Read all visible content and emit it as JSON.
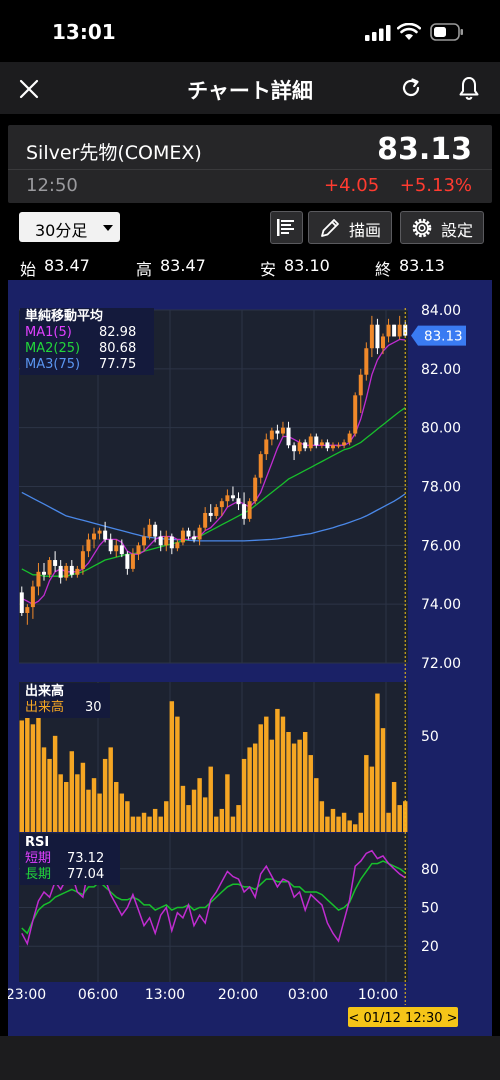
{
  "status_bar": {
    "time": "13:01"
  },
  "header": {
    "title": "チャート詳細"
  },
  "instrument": {
    "name": "Silver先物(COMEX)",
    "price": "83.13",
    "time": "12:50",
    "change": "+4.05",
    "change_pct": "+5.13%"
  },
  "toolbar": {
    "interval": "30分足",
    "draw_label": "描画",
    "settings_label": "設定"
  },
  "ohlc": {
    "open_label": "始",
    "open": "83.47",
    "high_label": "高",
    "high": "83.47",
    "low_label": "安",
    "low": "83.10",
    "close_label": "終",
    "close": "83.13"
  },
  "legends": {
    "ma_title": "単純移動平均",
    "ma1_label": "MA1(5)",
    "ma1_value": "82.98",
    "ma2_label": "MA2(25)",
    "ma2_value": "80.68",
    "ma3_label": "MA3(75)",
    "ma3_value": "77.75",
    "volume_title": "出来高",
    "volume_label": "出来高",
    "volume_value": "30",
    "rsi_title": "RSI",
    "rsi_short_label": "短期",
    "rsi_short_value": "73.12",
    "rsi_long_label": "長期",
    "rsi_long_value": "77.04"
  },
  "colors": {
    "up_candle": "#f0892a",
    "down_candle": "#ffffff",
    "ma1": "#c02cd0",
    "ma2": "#18c02c",
    "ma3": "#4a88e8",
    "volume": "#f5a623",
    "rsi_short": "#c02cd0",
    "rsi_long": "#18c02c",
    "chart_bg": "#1a2166",
    "crosshair": "#f5c518",
    "price_tag": "#3a7bf2"
  },
  "chart_data": [
    {
      "type": "candlestick",
      "title": "単純移動平均",
      "y_ticks": [
        "84.00",
        "82.00",
        "80.00",
        "78.00",
        "76.00",
        "74.00",
        "72.00"
      ],
      "ylim": [
        72,
        84
      ],
      "x_ticks": [
        "23:00",
        "06:00",
        "13:00",
        "20:00",
        "03:00",
        "10:00"
      ],
      "current_price_label": "83.13",
      "cursor_label": "< 01/12 12:30 >",
      "candles": [
        [
          74.4,
          74.6,
          73.6,
          73.7
        ],
        [
          73.7,
          74.0,
          73.3,
          73.9
        ],
        [
          73.9,
          74.8,
          73.5,
          74.6
        ],
        [
          74.6,
          75.4,
          74.3,
          75.1
        ],
        [
          75.1,
          75.4,
          74.8,
          75.0
        ],
        [
          75.0,
          75.6,
          74.9,
          75.5
        ],
        [
          75.5,
          75.8,
          75.1,
          75.3
        ],
        [
          75.3,
          75.5,
          74.7,
          74.9
        ],
        [
          74.9,
          75.4,
          74.8,
          75.3
        ],
        [
          75.3,
          75.5,
          74.9,
          75.0
        ],
        [
          75.0,
          75.3,
          74.9,
          75.2
        ],
        [
          75.2,
          76.0,
          75.0,
          75.8
        ],
        [
          75.8,
          76.4,
          75.6,
          76.2
        ],
        [
          76.2,
          76.6,
          75.9,
          76.4
        ],
        [
          76.4,
          76.6,
          76.2,
          76.5
        ],
        [
          76.5,
          76.8,
          76.1,
          76.2
        ],
        [
          76.2,
          76.4,
          75.7,
          75.8
        ],
        [
          75.8,
          76.2,
          75.6,
          76.0
        ],
        [
          76.0,
          76.2,
          75.6,
          75.7
        ],
        [
          75.7,
          75.8,
          75.0,
          75.2
        ],
        [
          75.2,
          75.9,
          75.1,
          75.7
        ],
        [
          75.7,
          76.1,
          75.5,
          76.0
        ],
        [
          76.0,
          76.6,
          75.8,
          76.3
        ],
        [
          76.3,
          76.9,
          76.2,
          76.7
        ],
        [
          76.7,
          76.8,
          76.1,
          76.3
        ],
        [
          76.3,
          76.5,
          75.8,
          76.0
        ],
        [
          76.0,
          76.5,
          75.8,
          76.3
        ],
        [
          76.3,
          76.4,
          75.7,
          75.9
        ],
        [
          75.9,
          76.2,
          75.8,
          76.1
        ],
        [
          76.1,
          76.6,
          76.0,
          76.5
        ],
        [
          76.5,
          76.6,
          76.2,
          76.3
        ],
        [
          76.3,
          76.5,
          76.1,
          76.2
        ],
        [
          76.2,
          76.7,
          76.0,
          76.6
        ],
        [
          76.6,
          77.3,
          76.5,
          77.1
        ],
        [
          77.1,
          77.4,
          76.8,
          77.0
        ],
        [
          77.0,
          77.4,
          76.9,
          77.3
        ],
        [
          77.3,
          77.6,
          77.0,
          77.5
        ],
        [
          77.5,
          77.9,
          77.3,
          77.7
        ],
        [
          77.7,
          78.0,
          77.5,
          77.6
        ],
        [
          77.6,
          77.8,
          77.2,
          77.4
        ],
        [
          77.4,
          77.8,
          76.7,
          76.9
        ],
        [
          76.9,
          77.6,
          76.8,
          77.5
        ],
        [
          77.5,
          78.4,
          77.4,
          78.3
        ],
        [
          78.3,
          79.2,
          78.1,
          79.1
        ],
        [
          79.1,
          79.8,
          78.9,
          79.6
        ],
        [
          79.6,
          80.0,
          79.4,
          79.9
        ],
        [
          79.9,
          80.1,
          79.6,
          79.8
        ],
        [
          79.8,
          80.2,
          79.7,
          80.0
        ],
        [
          80.0,
          80.2,
          79.3,
          79.4
        ],
        [
          79.4,
          79.5,
          78.9,
          79.2
        ],
        [
          79.2,
          79.6,
          79.1,
          79.5
        ],
        [
          79.5,
          79.6,
          79.2,
          79.3
        ],
        [
          79.3,
          79.8,
          79.2,
          79.7
        ],
        [
          79.7,
          79.8,
          79.3,
          79.4
        ],
        [
          79.4,
          79.6,
          79.3,
          79.5
        ],
        [
          79.5,
          79.6,
          79.2,
          79.3
        ],
        [
          79.3,
          79.5,
          79.2,
          79.4
        ],
        [
          79.4,
          79.5,
          79.3,
          79.4
        ],
        [
          79.4,
          79.6,
          79.3,
          79.5
        ],
        [
          79.5,
          79.9,
          79.4,
          79.8
        ],
        [
          79.8,
          81.2,
          79.7,
          81.1
        ],
        [
          81.1,
          82.0,
          80.5,
          81.8
        ],
        [
          81.8,
          82.9,
          81.6,
          82.7
        ],
        [
          82.7,
          83.8,
          82.4,
          83.5
        ],
        [
          83.5,
          83.7,
          82.5,
          82.7
        ],
        [
          82.7,
          83.2,
          82.5,
          83.1
        ],
        [
          83.1,
          83.7,
          82.9,
          83.5
        ],
        [
          83.5,
          83.5,
          83.1,
          83.1
        ],
        [
          83.1,
          83.8,
          83.0,
          83.5
        ],
        [
          83.5,
          83.6,
          83.1,
          83.13
        ]
      ],
      "ma1": [
        74.2,
        74.1,
        74.0,
        74.1,
        74.3,
        74.8,
        75.1,
        75.2,
        75.1,
        75.1,
        75.1,
        75.2,
        75.4,
        75.7,
        76.0,
        76.2,
        76.2,
        76.2,
        76.1,
        75.8,
        75.7,
        75.7,
        75.8,
        76.0,
        76.2,
        76.3,
        76.3,
        76.3,
        76.2,
        76.2,
        76.2,
        76.3,
        76.3,
        76.5,
        76.6,
        76.8,
        77.0,
        77.3,
        77.4,
        77.5,
        77.4,
        77.3,
        77.5,
        77.8,
        78.3,
        78.8,
        79.3,
        79.7,
        79.7,
        79.6,
        79.5,
        79.4,
        79.4,
        79.4,
        79.4,
        79.4,
        79.4,
        79.4,
        79.4,
        79.5,
        79.8,
        80.3,
        81.0,
        81.8,
        82.3,
        82.6,
        82.8,
        82.9,
        83.0,
        82.98
      ],
      "ma2": [
        75.2,
        75.1,
        75.0,
        75.0,
        74.95,
        74.95,
        74.95,
        74.95,
        74.95,
        75.0,
        75.05,
        75.1,
        75.2,
        75.3,
        75.4,
        75.5,
        75.55,
        75.6,
        75.65,
        75.7,
        75.72,
        75.75,
        75.8,
        75.85,
        75.9,
        75.95,
        76.0,
        76.05,
        76.1,
        76.15,
        76.2,
        76.25,
        76.3,
        76.4,
        76.5,
        76.6,
        76.7,
        76.8,
        76.9,
        77.0,
        77.1,
        77.2,
        77.35,
        77.5,
        77.65,
        77.8,
        77.95,
        78.1,
        78.25,
        78.35,
        78.45,
        78.55,
        78.65,
        78.75,
        78.85,
        78.95,
        79.05,
        79.15,
        79.25,
        79.3,
        79.4,
        79.5,
        79.65,
        79.8,
        79.95,
        80.1,
        80.25,
        80.4,
        80.55,
        80.68
      ],
      "ma3": [
        77.8,
        77.7,
        77.6,
        77.5,
        77.4,
        77.3,
        77.2,
        77.1,
        77.0,
        76.95,
        76.9,
        76.85,
        76.8,
        76.75,
        76.7,
        76.65,
        76.6,
        76.55,
        76.5,
        76.45,
        76.4,
        76.35,
        76.3,
        76.27,
        76.25,
        76.23,
        76.21,
        76.2,
        76.19,
        76.18,
        76.17,
        76.16,
        76.15,
        76.15,
        76.15,
        76.15,
        76.15,
        76.15,
        76.15,
        76.15,
        76.15,
        76.16,
        76.17,
        76.18,
        76.19,
        76.2,
        76.22,
        76.25,
        76.28,
        76.31,
        76.34,
        76.37,
        76.4,
        76.45,
        76.5,
        76.55,
        76.6,
        76.66,
        76.72,
        76.78,
        76.85,
        76.92,
        77.0,
        77.1,
        77.2,
        77.3,
        77.4,
        77.5,
        77.62,
        77.75
      ]
    },
    {
      "type": "bar",
      "title": "出来高",
      "y_ticks": [
        "50"
      ],
      "values": [
        58,
        62,
        56,
        60,
        44,
        38,
        50,
        30,
        26,
        42,
        30,
        36,
        22,
        28,
        20,
        38,
        44,
        26,
        20,
        16,
        8,
        8,
        10,
        8,
        12,
        8,
        16,
        68,
        60,
        24,
        14,
        22,
        28,
        18,
        34,
        8,
        12,
        30,
        8,
        14,
        38,
        44,
        46,
        56,
        60,
        48,
        64,
        60,
        52,
        46,
        48,
        52,
        40,
        28,
        16,
        8,
        12,
        8,
        10,
        6,
        4,
        10,
        40,
        34,
        72,
        54,
        10,
        26,
        14,
        16
      ]
    },
    {
      "type": "line",
      "title": "RSI",
      "y_ticks": [
        "80",
        "50",
        "20"
      ],
      "ylim": [
        0,
        100
      ],
      "series": [
        {
          "name": "短期",
          "values": [
            30,
            22,
            40,
            55,
            62,
            58,
            70,
            64,
            72,
            76,
            62,
            58,
            80,
            76,
            88,
            72,
            60,
            52,
            44,
            50,
            60,
            48,
            36,
            42,
            30,
            44,
            50,
            32,
            46,
            42,
            52,
            36,
            44,
            38,
            56,
            62,
            70,
            78,
            74,
            72,
            62,
            66,
            58,
            76,
            82,
            74,
            66,
            72,
            70,
            58,
            62,
            48,
            60,
            56,
            52,
            38,
            30,
            24,
            40,
            56,
            82,
            86,
            92,
            94,
            88,
            90,
            84,
            80,
            76,
            73.12
          ]
        },
        {
          "name": "長期",
          "values": [
            34,
            30,
            40,
            48,
            52,
            54,
            58,
            60,
            62,
            64,
            62,
            60,
            66,
            66,
            70,
            66,
            62,
            58,
            56,
            56,
            58,
            56,
            52,
            52,
            48,
            50,
            52,
            48,
            50,
            50,
            52,
            48,
            50,
            50,
            54,
            58,
            62,
            66,
            68,
            68,
            66,
            66,
            64,
            68,
            72,
            72,
            70,
            70,
            70,
            66,
            66,
            62,
            62,
            62,
            60,
            56,
            52,
            48,
            50,
            54,
            64,
            72,
            78,
            84,
            84,
            86,
            84,
            82,
            80,
            77.04
          ]
        }
      ]
    }
  ]
}
